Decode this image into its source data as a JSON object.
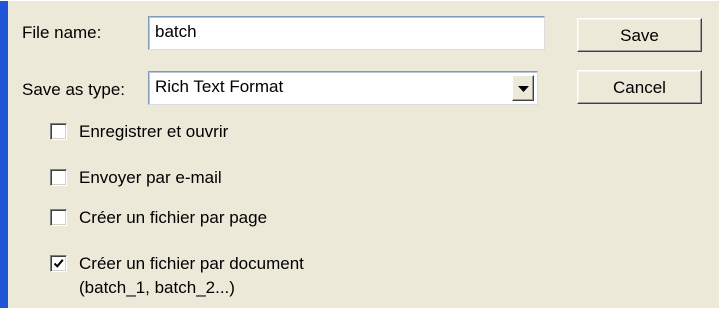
{
  "file_name": {
    "label": "File name:",
    "value": "batch"
  },
  "save_as_type": {
    "label": "Save as type:",
    "selected": "Rich Text Format"
  },
  "buttons": {
    "save": "Save",
    "cancel": "Cancel"
  },
  "options": [
    {
      "label": "Enregistrer et ouvrir",
      "checked": false
    },
    {
      "label": "Envoyer par e-mail",
      "checked": false
    },
    {
      "label": "Créer un fichier par page",
      "checked": false
    },
    {
      "label": "Créer un fichier par document",
      "sublabel": "(batch_1, batch_2...)",
      "checked": true
    }
  ],
  "colors": {
    "dialog_background": "#ece9d8",
    "left_accent": "#1e56d6",
    "field_border": "#7f9db9"
  }
}
